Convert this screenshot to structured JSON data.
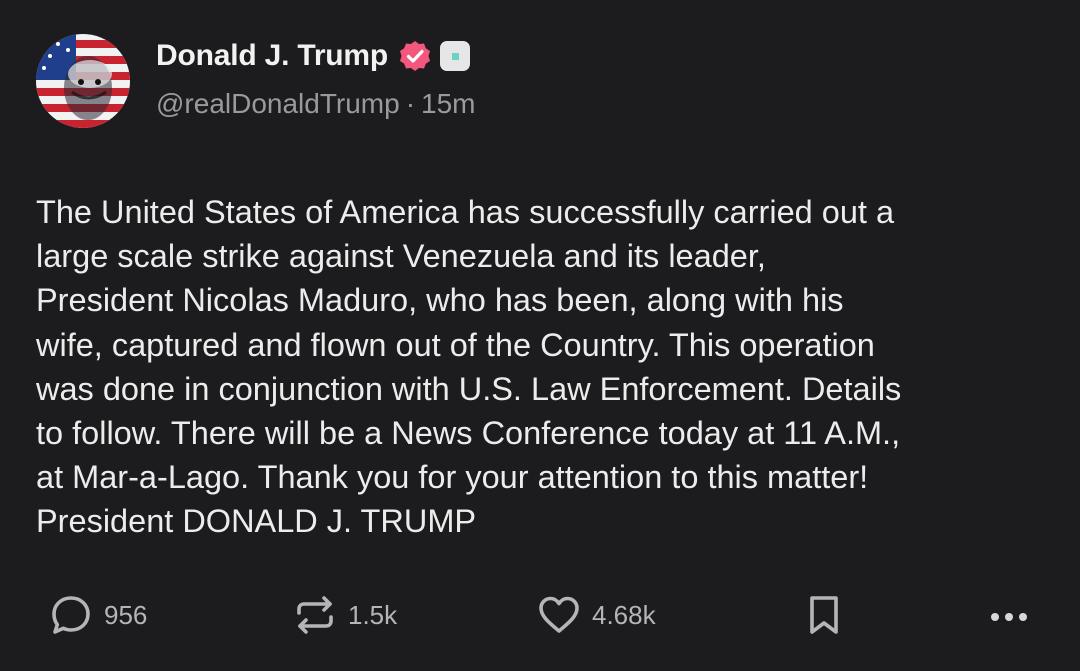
{
  "post": {
    "author_name": "Donald J. Trump",
    "handle": "@realDonaldTrump",
    "separator": "·",
    "time_ago": "15m",
    "body_lines": [
      "The United States of America has successfully carried out a",
      "large scale strike against Venezuela and its leader,",
      "President Nicolas Maduro, who has been, along with his",
      "wife, captured and flown out of the Country. This operation",
      "was done in conjunction with U.S. Law Enforcement. Details",
      "to follow. There will be a News Conference today at 11 A.M.,",
      "at Mar-a-Lago. Thank you for your attention to this matter!",
      "President DONALD J. TRUMP"
    ]
  },
  "actions": {
    "reply_count": "956",
    "retruth_count": "1.5k",
    "like_count": "4.68k"
  },
  "icons": {
    "reply": "speech-bubble-icon",
    "retruth": "repost-arrows-icon",
    "like": "heart-icon",
    "bookmark": "bookmark-icon",
    "more": "more-dots-icon",
    "verified": "verified-badge-icon"
  },
  "colors": {
    "background": "#1c1c1e",
    "text": "#ececec",
    "muted": "#9a9a9e",
    "verified_badge": "#f4577d",
    "icon": "#b5b5b8"
  }
}
